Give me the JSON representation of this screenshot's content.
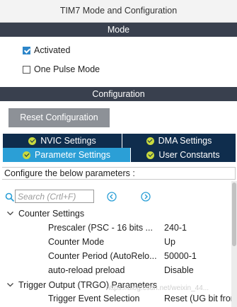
{
  "window": {
    "title": "TIM7 Mode and Configuration"
  },
  "mode": {
    "header": "Mode",
    "options": [
      {
        "label": "Activated",
        "checked": true
      },
      {
        "label": "One Pulse Mode",
        "checked": false
      }
    ]
  },
  "configuration": {
    "header": "Configuration",
    "reset_label": "Reset Configuration",
    "tabs": [
      {
        "label": "NVIC Settings",
        "active": false
      },
      {
        "label": "DMA Settings",
        "active": false
      },
      {
        "label": "Parameter Settings",
        "active": true
      },
      {
        "label": "User Constants",
        "active": false
      }
    ],
    "configure_text": "Configure the below parameters :"
  },
  "search": {
    "placeholder": "Search (Crtl+F)"
  },
  "parameters": {
    "counter_settings": {
      "label": "Counter Settings",
      "rows": [
        {
          "name": "Prescaler (PSC - 16 bits ...",
          "value": "240-1"
        },
        {
          "name": "Counter Mode",
          "value": "Up"
        },
        {
          "name": "Counter Period (AutoRelo...",
          "value": "50000-1"
        },
        {
          "name": "auto-reload preload",
          "value": "Disable"
        }
      ]
    },
    "trigger_output": {
      "label": "Trigger Output (TRGO) Parameters",
      "rows": [
        {
          "name": "Trigger Event Selection",
          "value": "Reset (UG bit from"
        }
      ]
    }
  },
  "watermark": "https://blog.csdn.net/weixin_44...",
  "colors": {
    "section_bar": "#39404e",
    "tab_dark": "#0f2d4d",
    "tab_active": "#2b9fd6",
    "tab_check": "#c8d93e",
    "checkbox_checked": "#2d86c9",
    "nav_icon": "#2b9fd6"
  }
}
